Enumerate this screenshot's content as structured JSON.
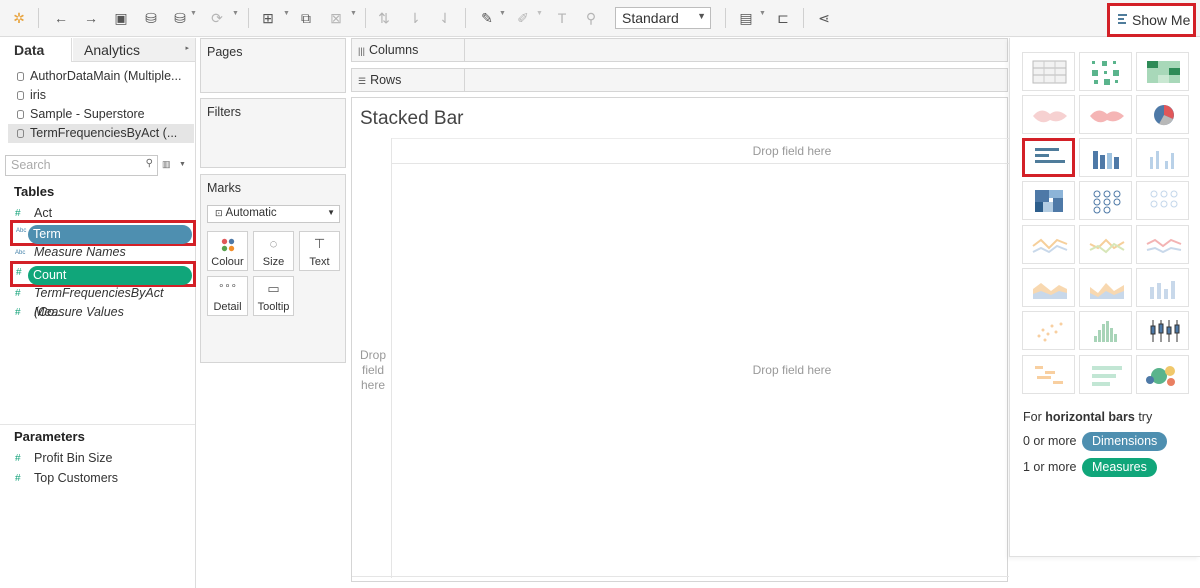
{
  "toolbar": {
    "icons": [
      "tableau-logo-icon",
      "back-icon",
      "forward-icon",
      "save-icon",
      "new-datasource-icon",
      "pause-icon",
      "refresh-icon",
      "new-worksheet-icon",
      "duplicate-icon",
      "clear-icon",
      "swap-icon",
      "sort-ascending-icon",
      "sort-descending-icon",
      "highlight-icon",
      "annotate-icon",
      "labels-icon",
      "pin-icon",
      "chart-view-icon",
      "presentation-icon",
      "share-icon"
    ],
    "fit_select": "Standard",
    "show_me_label": "Show Me"
  },
  "data_pane": {
    "tab_data": "Data",
    "tab_analytics": "Analytics",
    "datasources": [
      {
        "label": "AuthorDataMain (Multiple..."
      },
      {
        "label": "iris"
      },
      {
        "label": "Sample - Superstore"
      },
      {
        "label": "TermFrequenciesByAct (..."
      }
    ],
    "search_placeholder": "Search",
    "tables_title": "Tables",
    "fields": {
      "act": "Act",
      "term": "Term",
      "measure_names": "Measure Names",
      "count": "Count",
      "term_freq": "TermFrequenciesByAct (Co...",
      "measure_values": "Measure Values"
    },
    "type_abc": "Abc",
    "parameters_title": "Parameters",
    "parameters": [
      {
        "label": "Profit Bin Size"
      },
      {
        "label": "Top Customers"
      }
    ]
  },
  "shelves": {
    "pages": "Pages",
    "filters": "Filters",
    "marks": "Marks",
    "marks_type": "Automatic",
    "marks_buttons": {
      "colour": "Colour",
      "size": "Size",
      "text": "Text",
      "detail": "Detail",
      "tooltip": "Tooltip"
    },
    "columns": "Columns",
    "rows": "Rows"
  },
  "canvas": {
    "title": "Stacked Bar",
    "drop_top": "Drop field here",
    "drop_center": "Drop field here",
    "drop_left_1": "Drop",
    "drop_left_2": "field",
    "drop_left_3": "here"
  },
  "show_me": {
    "chart_types": [
      "text-table",
      "heat-map",
      "highlight-table",
      "symbol-map",
      "filled-map",
      "pie-chart",
      "horizontal-bars",
      "stacked-bars",
      "side-by-side-bars",
      "treemap",
      "circle-view",
      "side-by-side-circles",
      "lines-continuous",
      "lines-discrete",
      "dual-lines",
      "area-continuous",
      "area-discrete",
      "dual-combination",
      "scatter-plot",
      "histogram",
      "box-and-whisker",
      "gantt-chart",
      "bullet-graph",
      "packed-bubbles"
    ],
    "hint_prefix": "For",
    "hint_bold": "horizontal bars",
    "hint_suffix": "try",
    "dim_prefix": "0 or more",
    "dim_pill": "Dimensions",
    "meas_prefix": "1 or more",
    "meas_pill": "Measures"
  }
}
